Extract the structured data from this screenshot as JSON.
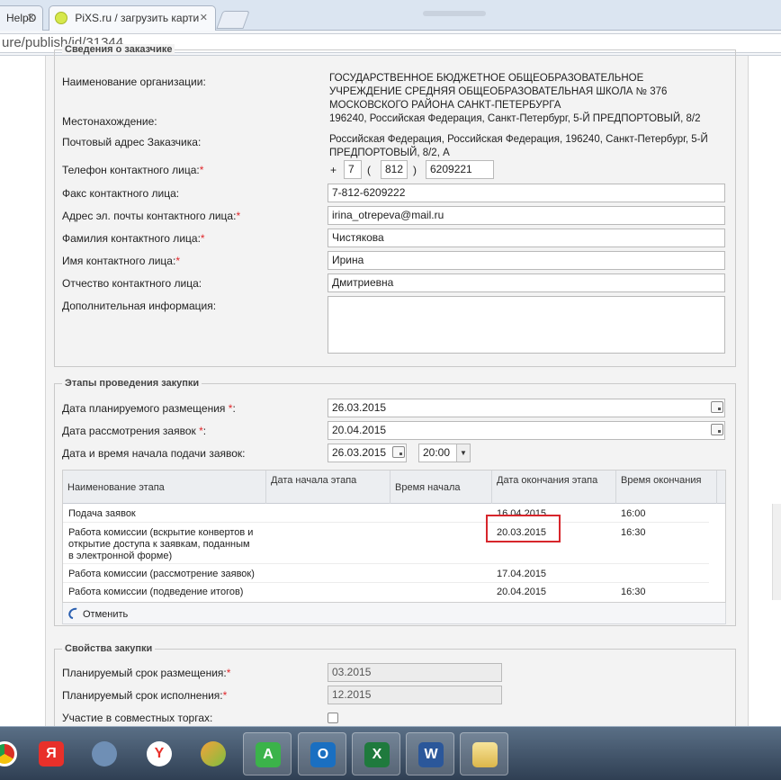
{
  "browser": {
    "tabs": [
      {
        "label": "HelpD",
        "active": false
      },
      {
        "label": "PiXS.ru / загрузить карти",
        "active": true
      }
    ],
    "close_glyph": "✕",
    "address": "ure/publish/id/31344"
  },
  "customer_section": {
    "legend": "Сведения о заказчике",
    "org_name_label": "Наименование организации:",
    "org_name_value": "ГОСУДАРСТВЕННОЕ БЮДЖЕТНОЕ ОБЩЕОБРАЗОВАТЕЛЬНОЕ УЧРЕЖДЕНИЕ СРЕДНЯЯ ОБЩЕОБРАЗОВАТЕЛЬНАЯ ШКОЛА № 376 МОСКОВСКОГО РАЙОНА САНКТ-ПЕТЕРБУРГА",
    "location_label": "Местонахождение:",
    "location_value": "196240, Российская Федерация, Санкт-Петербург, 5-Й ПРЕДПОРТОВЫЙ, 8/2",
    "postal_label": "Почтовый адрес Заказчика:",
    "postal_value": "Российская Федерация, Российская Федерация, 196240, Санкт-Петербург, 5-Й ПРЕДПОРТОВЫЙ, 8/2, А",
    "phone_label": "Телефон контактного лица:",
    "phone_plus": "+",
    "phone_open": "(",
    "phone_close": ")",
    "phone_country": "7",
    "phone_code": "812",
    "phone_number": "6209221",
    "fax_label": "Факс контактного лица:",
    "fax_value": "7-812-6209222",
    "email_label": "Адрес эл. почты контактного лица:",
    "email_value": "irina_otrepeva@mail.ru",
    "surname_label": "Фамилия контактного лица:",
    "surname_value": "Чистякова",
    "name_label": "Имя контактного лица:",
    "name_value": "Ирина",
    "patronymic_label": "Отчество контактного лица:",
    "patronymic_value": "Дмитриевна",
    "extra_label": "Дополнительная информация:",
    "extra_value": "",
    "required_mark": "*"
  },
  "stages_section": {
    "legend": "Этапы проведения закупки",
    "planned_date_label": "Дата планируемого размещения",
    "planned_date_value": "26.03.2015",
    "review_date_label": "Дата рассмотрения заявок",
    "review_date_value": "20.04.2015",
    "start_label": "Дата и время начала подачи заявок:",
    "start_date_value": "26.03.2015",
    "start_time_value": "20:00",
    "table": {
      "headers": [
        "Наименование этапа",
        "Дата начала этапа",
        "Время начала",
        "Дата окончания этапа",
        "Время окончания"
      ],
      "rows": [
        {
          "name": "Подача заявок",
          "start_date": "",
          "start_time": "",
          "end_date": "16.04.2015",
          "end_time": "16:00"
        },
        {
          "name": "Работа комиссии (вскрытие конвертов и открытие доступа к заявкам, поданным в электронной форме)",
          "start_date": "",
          "start_time": "",
          "end_date": "20.03.2015",
          "end_time": "16:30"
        },
        {
          "name": "Работа комиссии (рассмотрение заявок)",
          "start_date": "",
          "start_time": "",
          "end_date": "17.04.2015",
          "end_time": ""
        },
        {
          "name": "Работа комиссии (подведение итогов)",
          "start_date": "",
          "start_time": "",
          "end_date": "20.04.2015",
          "end_time": "16:30"
        }
      ],
      "cancel_label": "Отменить"
    }
  },
  "props_section": {
    "legend": "Свойства закупки",
    "placement_term_label": "Планируемый срок размещения:",
    "placement_term_value": "03.2015",
    "execution_term_label": "Планируемый срок исполнения:",
    "execution_term_value": "12.2015",
    "joint_label": "Участие в совместных торгах:"
  },
  "taskbar": {
    "icons": [
      "chrome-icon",
      "yandex-ya-icon",
      "speaker-icon",
      "yandex-browser-icon",
      "disk-icon",
      "green-a-icon",
      "outlook-icon",
      "excel-icon",
      "word-icon",
      "folder-icon"
    ],
    "labels": [
      "",
      "Я",
      "",
      "Y",
      "",
      "A",
      "O",
      "X",
      "W",
      ""
    ],
    "colors": {
      "yandex": "#e8302a",
      "outlook": "#1a6fc1",
      "excel": "#1f7a3d",
      "word": "#2b579a",
      "green": "#3bb34a",
      "chrome_red": "#d93025"
    }
  }
}
